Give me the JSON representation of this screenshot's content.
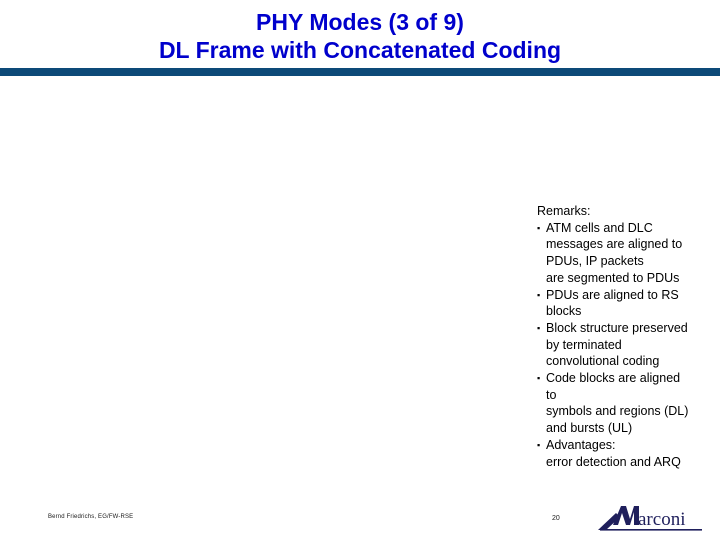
{
  "slide": {
    "title_lines": [
      "PHY Modes (3 of 9)",
      "DL Frame with Concatenated Coding"
    ],
    "title_color": "#0000CC",
    "rule_color": "#0D4A78"
  },
  "remarks": {
    "heading": "Remarks:",
    "bullet_glyph": "▪",
    "items": [
      {
        "lines": [
          "ATM cells and DLC",
          "messages are aligned to",
          "PDUs, IP packets",
          "are segmented to PDUs"
        ]
      },
      {
        "lines": [
          "PDUs are aligned to RS",
          "blocks"
        ]
      },
      {
        "lines": [
          "Block structure preserved",
          "by terminated",
          "convolutional coding"
        ]
      },
      {
        "lines": [
          "Code blocks are aligned",
          "to",
          "symbols and regions (DL)",
          "and bursts (UL)"
        ]
      },
      {
        "lines": [
          "Advantages:",
          "error detection and ARQ"
        ]
      }
    ]
  },
  "footer": {
    "author": "Bernd Friedrichs, EG/FW-RSE",
    "page_number": "20",
    "logo_text": "arconi",
    "logo_color": "#1F1F5C"
  }
}
